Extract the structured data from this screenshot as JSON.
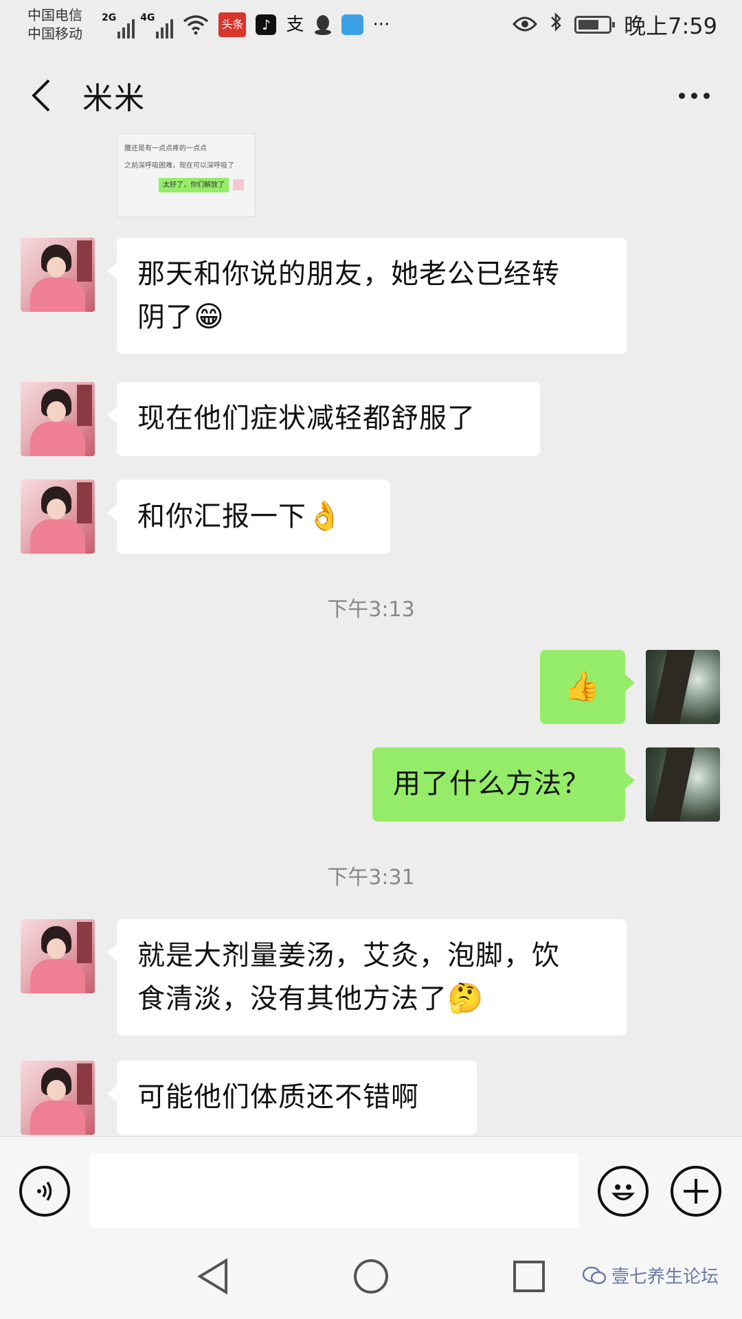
{
  "status_bar": {
    "carrier_1": "中国电信",
    "carrier_2": "中国移动",
    "net_1": "2G",
    "net_2": "4G",
    "app_badge_toutiao": "头条",
    "app_badge_tiktok": "♪",
    "app_icon_zhi": "支",
    "more": "···",
    "time": "晚上7:59",
    "battery_level": 0.7
  },
  "header": {
    "title": "米米"
  },
  "shared_screenshot": {
    "line_1": "腰还是有一点点疼的一点点",
    "line_2": "之前深呼吸困难，现在可以深呼吸了",
    "reply": "太好了，你们解放了"
  },
  "messages": [
    {
      "side": "in",
      "text": "那天和你说的朋友，她老公已经转",
      "text_2": "阴了",
      "emoji": "😁"
    },
    {
      "side": "in",
      "text": "现在他们症状减轻都舒服了"
    },
    {
      "side": "in",
      "text": "和你汇报一下",
      "emoji": "👌"
    },
    {
      "side": "out",
      "emoji": "👍"
    },
    {
      "side": "out",
      "text": "用了什么方法？"
    },
    {
      "side": "in",
      "text": "就是大剂量姜汤，艾灸，泡脚，饮",
      "text_2": "食清淡，没有其他方法了",
      "emoji": "🤔"
    },
    {
      "side": "in",
      "text": "可能他们体质还不错啊"
    }
  ],
  "timestamps": [
    "下午3:13",
    "下午3:31"
  ],
  "input_bar": {
    "placeholder": ""
  },
  "watermark": "壹七养生论坛"
}
